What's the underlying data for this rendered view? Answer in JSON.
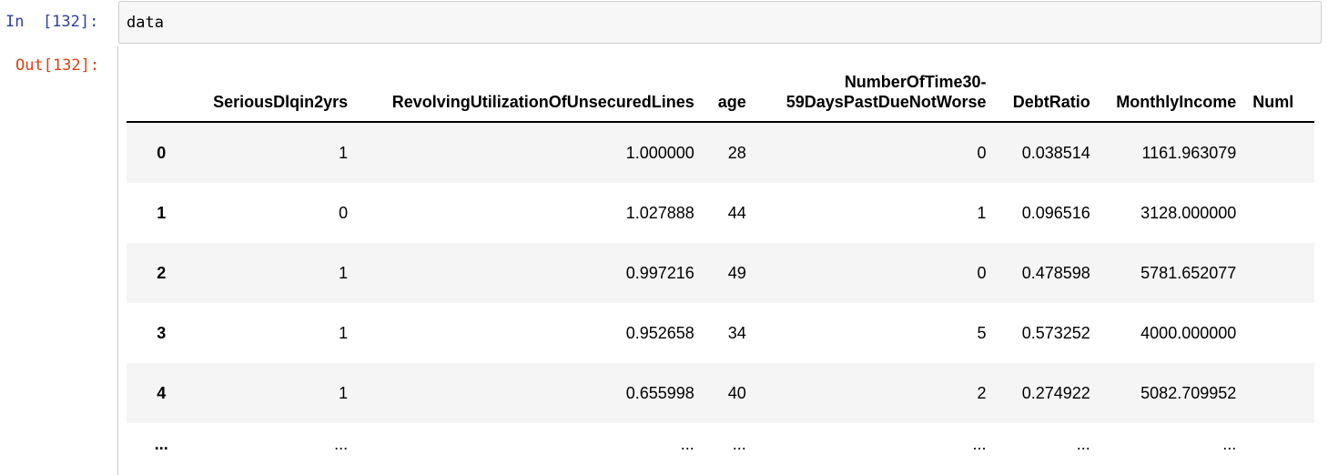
{
  "cell": {
    "in_prompt": "In  [132]:",
    "out_prompt": "Out[132]:",
    "code": "data"
  },
  "table": {
    "columns": [
      "SeriousDlqin2yrs",
      "RevolvingUtilizationOfUnsecuredLines",
      "age",
      "NumberOfTime30-59DaysPastDueNotWorse",
      "DebtRatio",
      "MonthlyIncome",
      "Numl"
    ],
    "rows": [
      {
        "index": "0",
        "cells": [
          "1",
          "1.000000",
          "28",
          "0",
          "0.038514",
          "1161.963079",
          ""
        ]
      },
      {
        "index": "1",
        "cells": [
          "0",
          "1.027888",
          "44",
          "1",
          "0.096516",
          "3128.000000",
          ""
        ]
      },
      {
        "index": "2",
        "cells": [
          "1",
          "0.997216",
          "49",
          "0",
          "0.478598",
          "5781.652077",
          ""
        ]
      },
      {
        "index": "3",
        "cells": [
          "1",
          "0.952658",
          "34",
          "5",
          "0.573252",
          "4000.000000",
          ""
        ]
      },
      {
        "index": "4",
        "cells": [
          "1",
          "0.655998",
          "40",
          "2",
          "0.274922",
          "5082.709952",
          ""
        ]
      },
      {
        "index": "...",
        "cells": [
          "...",
          "...",
          "...",
          "...",
          "...",
          "...",
          ""
        ]
      }
    ]
  }
}
